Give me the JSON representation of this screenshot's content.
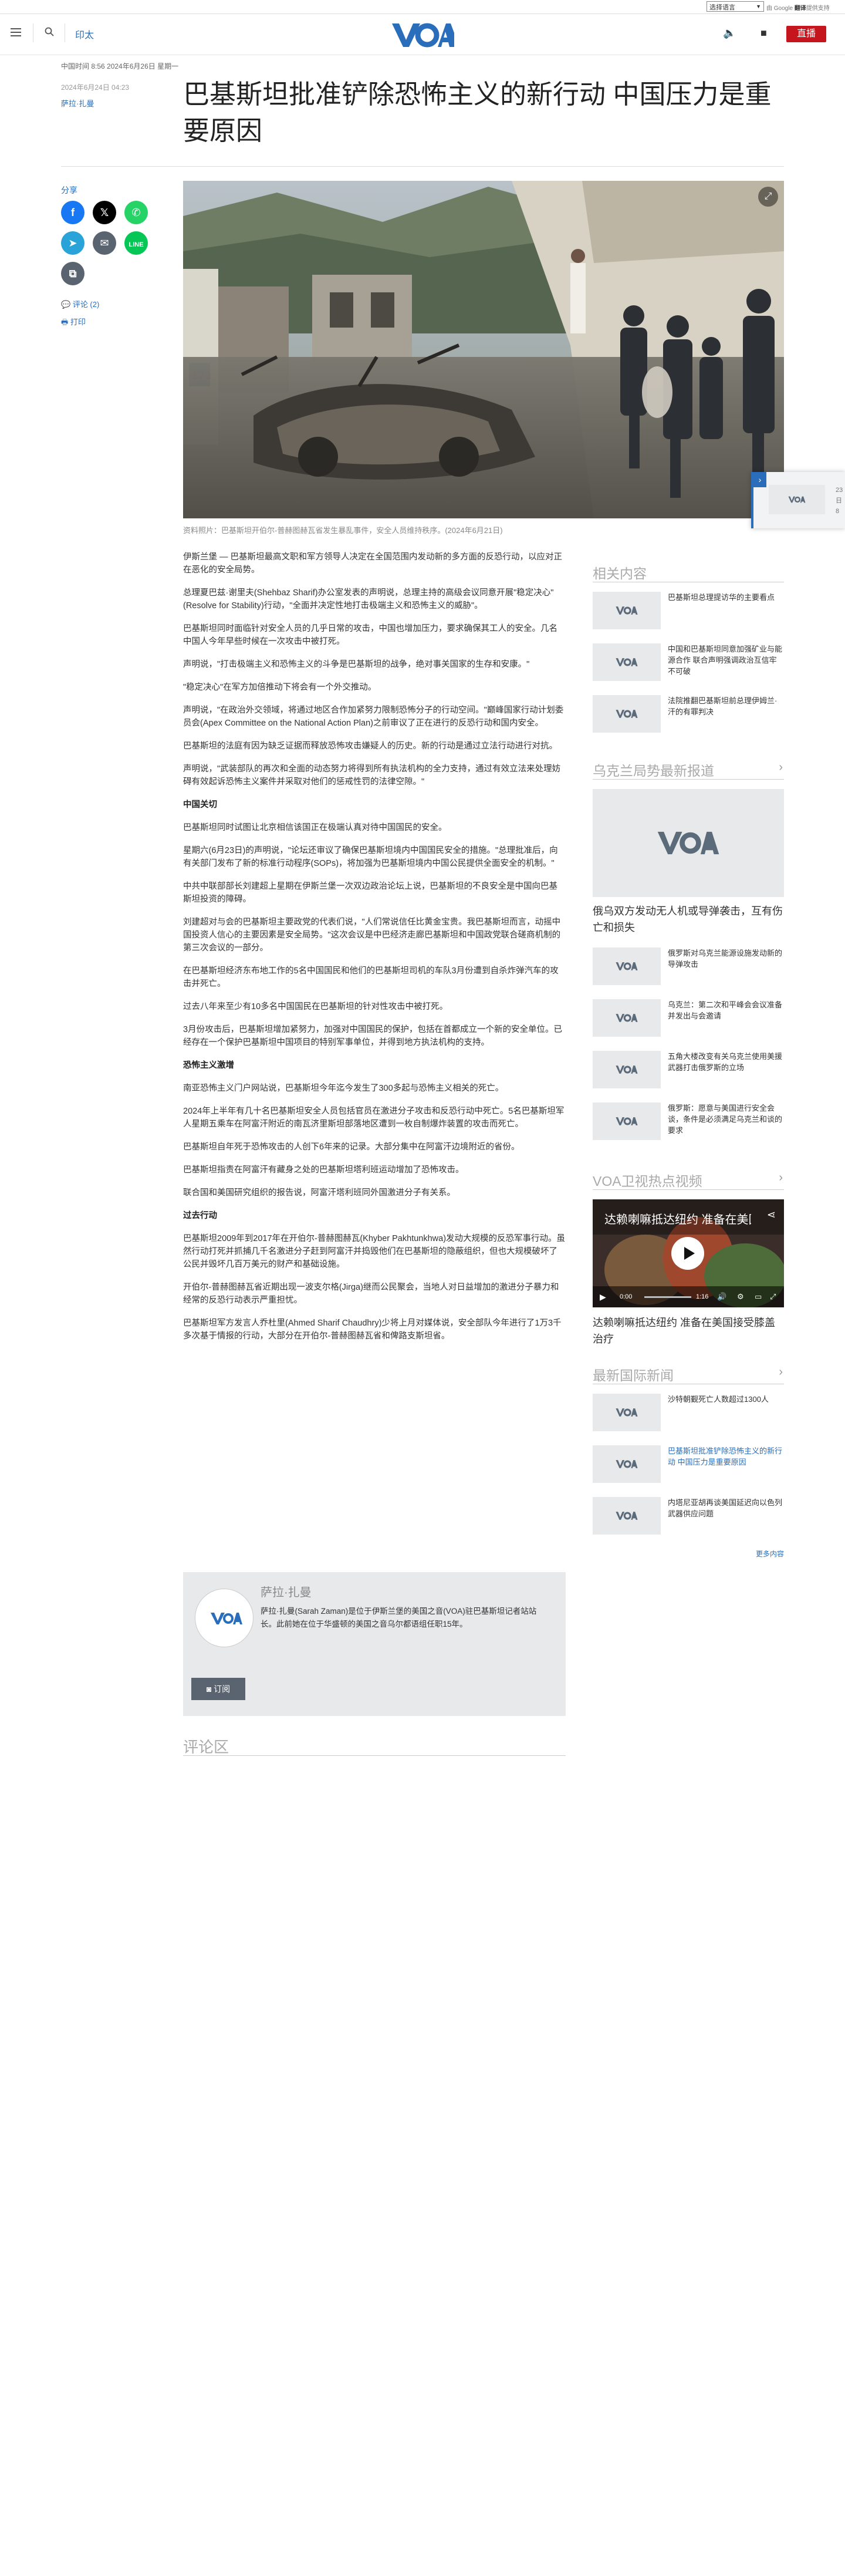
{
  "topbar": {
    "language_select": "选择语言",
    "powered_by_prefix": "由 Google",
    "translate_word": "翻译",
    "powered_by_suffix": "提供支持"
  },
  "header": {
    "vernacular_link": "印太",
    "logo_text": "VOA",
    "live_label": "直播"
  },
  "article": {
    "dateline": "中国时间 8:56 2024年6月26日 星期一",
    "published": "2024年6月24日 04:23",
    "author": "萨拉·扎曼",
    "headline": "巴基斯坦批准铲除恐怖主义的新行动 中国压力是重要原因",
    "share_label": "分享",
    "comments_link": "评论 (2)",
    "print_link": "打印",
    "caption": "资料照片：巴基斯坦开伯尔-普赫图赫瓦省发生暴乱事件，安全人员维持秩序。(2024年6月21日)",
    "paragraphs": [
      {
        "type": "p",
        "text": "伊斯兰堡 — 巴基斯坦最高文职和军方领导人决定在全国范围内发动新的多方面的反恐行动，以应对正在恶化的安全局势。"
      },
      {
        "type": "p",
        "text": "总理夏巴兹·谢里夫(Shehbaz Sharif)办公室发表的声明说，总理主持的高级会议同意开展\"稳定决心\"(Resolve for Stability)行动，\"全面并决定性地打击极端主义和恐怖主义的威胁\"。"
      },
      {
        "type": "p",
        "text": "巴基斯坦同时面临针对安全人员的几乎日常的攻击，中国也增加压力，要求确保其工人的安全。几名中国人今年早些时候在一次攻击中被打死。"
      },
      {
        "type": "p",
        "text": "声明说，\"打击极端主义和恐怖主义的斗争是巴基斯坦的战争，绝对事关国家的生存和安康。\""
      },
      {
        "type": "p",
        "text": "\"稳定决心\"在军方加倍推动下将会有一个外交推动。"
      },
      {
        "type": "p",
        "text": "声明说，\"在政治外交领域，将通过地区合作加紧努力限制恐怖分子的行动空间。\"巅峰国家行动计划委员会(Apex Committee on the National Action Plan)之前审议了正在进行的反恐行动和国内安全。"
      },
      {
        "type": "p",
        "text": "巴基斯坦的法庭有因为缺乏证据而释放恐怖攻击嫌疑人的历史。新的行动是通过立法行动进行对抗。"
      },
      {
        "type": "p",
        "text": "声明说，\"武装部队的再次和全面的动态努力将得到所有执法机构的全力支持，通过有效立法来处理妨碍有效起诉恐怖主义案件并采取对他们的惩戒性罚的法律空隙。\""
      },
      {
        "type": "h",
        "text": "中国关切"
      },
      {
        "type": "p",
        "text": "巴基斯坦同时试图让北京相信该国正在极端认真对待中国国民的安全。"
      },
      {
        "type": "p",
        "text": "星期六(6月23日)的声明说，\"论坛还审议了确保巴基斯坦境内中国国民安全的措施。\"总理批准后，向有关部门发布了新的标准行动程序(SOPs)，将加强为巴基斯坦境内中国公民提供全面安全的机制。\""
      },
      {
        "type": "p",
        "text": "中共中联部部长刘建超上星期在伊斯兰堡一次双边政治论坛上说，巴基斯坦的不良安全是中国向巴基斯坦投资的障碍。"
      },
      {
        "type": "p",
        "text": "刘建超对与会的巴基斯坦主要政党的代表们说，\"人们常说信任比黄金宝贵。我巴基斯坦而言，动摇中国投资人信心的主要因素是安全局势。\"这次会议是中巴经济走廊巴基斯坦和中国政党联合磋商机制的第三次会议的一部分。"
      },
      {
        "type": "p",
        "text": "在巴基斯坦经济东布地工作的5名中国国民和他们的巴基斯坦司机的车队3月份遭到自杀炸弹汽车的攻击并死亡。"
      },
      {
        "type": "p",
        "text": "过去八年来至少有10多名中国国民在巴基斯坦的针对性攻击中被打死。"
      },
      {
        "type": "p",
        "text": "3月份攻击后，巴基斯坦增加紧努力，加强对中国国民的保护，包括在首都成立一个新的安全单位。已经存在一个保护巴基斯坦中国项目的特别军事单位，并得到地方执法机构的支持。"
      },
      {
        "type": "h",
        "text": "恐怖主义激增"
      },
      {
        "type": "p",
        "text": "南亚恐怖主义门户网站说，巴基斯坦今年迄今发生了300多起与恐怖主义相关的死亡。"
      },
      {
        "type": "p",
        "text": "2024年上半年有几十名巴基斯坦安全人员包括官员在激进分子攻击和反恐行动中死亡。5名巴基斯坦军人星期五乘车在阿富汗附近的南瓦济里斯坦部落地区遭到一枚自制爆炸装置的攻击而死亡。"
      },
      {
        "type": "p",
        "text": "巴基斯坦自年死于恐怖攻击的人创下6年来的记录。大部分集中在阿富汗边境附近的省份。"
      },
      {
        "type": "p",
        "text": "巴基斯坦指责在阿富汗有藏身之处的巴基斯坦塔利班运动增加了恐怖攻击。"
      },
      {
        "type": "p",
        "text": "联合国和美国研究组织的报告说，阿富汗塔利班同外国激进分子有关系。"
      },
      {
        "type": "h",
        "text": "过去行动"
      },
      {
        "type": "p",
        "text": "巴基斯坦2009年到2017年在开伯尔-普赫图赫瓦(Khyber Pakhtunkhwa)发动大规模的反恐军事行动。虽然行动打死并抓捕几千名激进分子赶到阿富汗并捣毁他们在巴基斯坦的隐蔽组织，但也大规模破坏了公民并毁坏几百万美元的财产和基础设施。"
      },
      {
        "type": "p",
        "text": "开伯尔-普赫图赫瓦省近期出现一波支尔格(Jirga)继而公民聚会，当地人对日益增加的激进分子暴力和经常的反恐行动表示严重担忧。"
      },
      {
        "type": "p",
        "text": "巴基斯坦军方发言人乔杜里(Ahmed Sharif Chaudhry)少将上月对媒体说，安全部队今年进行了1万3千多次基于情报的行动，大部分在开伯尔-普赫图赫瓦省和俾路支斯坦省。"
      }
    ],
    "bio": {
      "name": "萨拉·扎曼",
      "text": "萨拉·扎曼(Sarah Zaman)是位于伊斯兰堡的美国之音(VOA)驻巴基斯坦记者站站长。此前她在位于华盛顿的美国之音乌尔都语组任职15年。",
      "subscribe": "订阅"
    },
    "comments_title": "评论区"
  },
  "rail": {
    "related_title": "相关内容",
    "related": [
      "巴基斯坦总理提访华的主要看点",
      "中国和巴基斯坦同意加强矿业与能源合作 联合声明强调政治互信牢不可破",
      "法院推翻巴基斯坦前总理伊姆兰·汗的有罪判决"
    ],
    "ukraine_title": "乌克兰局势最新报道",
    "ukraine_lead": "俄乌双方发动无人机或导弹袭击，互有伤亡和损失",
    "ukraine": [
      "俄罗斯对乌克兰能源设施发动新的导弹攻击",
      "乌克兰：第二次和平峰会会议准备并发出与会邀请",
      "五角大楼改变有关乌克兰使用美援武器打击俄罗斯的立场",
      "俄罗斯：愿意与美国进行安全会谈，条件是必须满足乌克兰和谈的要求"
    ],
    "video_title": "VOA卫视热点视频",
    "video_headline": "达赖喇嘛抵达纽约 准备在美国接受膝盖治疗",
    "video_time": "0:00",
    "video_duration": "1:16",
    "news_title": "最新国际新闻",
    "news": [
      "沙特朝觐死亡人数超过1300人",
      "巴基斯坦批准铲除恐怖主义的新行动 中国压力是重要原因",
      "内塔尼亚胡再谈美国延迟向以色列武器供应问题"
    ],
    "more_link": "更多内容"
  },
  "float": {
    "text": "23日 8"
  },
  "colors": {
    "brand_blue": "#2a6ebb",
    "live_red": "#c4161c",
    "facebook": "#1877f2",
    "x": "#000000",
    "whatsapp": "#25d366",
    "telegram": "#2aa3d8",
    "email": "#5a6470",
    "line": "#06c755",
    "copy": "#5a6470"
  }
}
